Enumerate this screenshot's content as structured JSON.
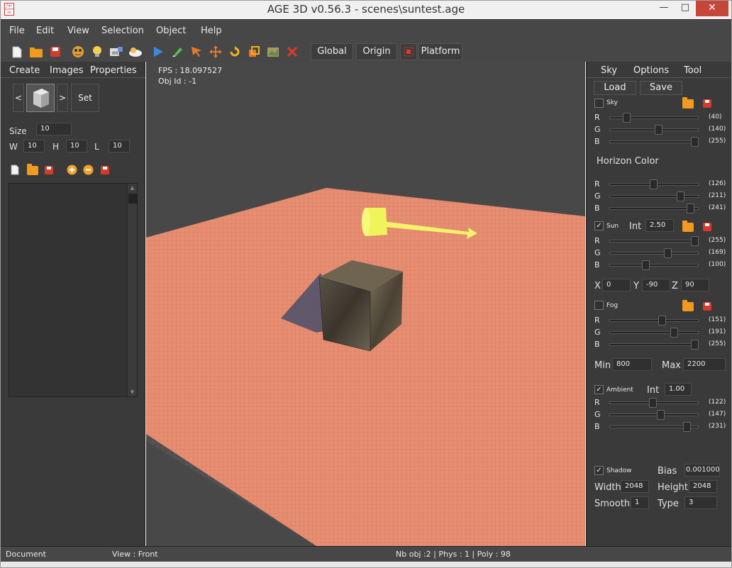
{
  "window": {
    "title": "AGE 3D v0.56.3 - scenes\\suntest.age",
    "app_icon_text": "Age Game Kit",
    "min": "—",
    "max": "□",
    "close": "✕"
  },
  "menu": [
    "File",
    "Edit",
    "View",
    "Selection",
    "Object",
    "Help"
  ],
  "toolbar": {
    "icons": [
      "new-file-icon",
      "open-folder-icon",
      "save-icon",
      "character-icon",
      "bulb-icon",
      "sprite-icon",
      "sky-icon",
      "play-icon",
      "pencil-icon",
      "select-arrow-icon",
      "move-icon",
      "rotate-icon",
      "scale-icon",
      "terrain-icon",
      "delete-icon"
    ],
    "global": "Global",
    "origin": "Origin",
    "platform": "Platform"
  },
  "left": {
    "tabs": [
      "Create",
      "Images",
      "Properties"
    ],
    "prev": "<",
    "next": ">",
    "set": "Set",
    "size_label": "Size",
    "size": "10",
    "w_label": "W",
    "w": "10",
    "h_label": "H",
    "h": "10",
    "l_label": "L",
    "l": "10"
  },
  "viewport": {
    "fps": "FPS : 18.097527",
    "objid": "Obj Id : -1"
  },
  "right": {
    "tabs": [
      "Sky",
      "Options",
      "Tool"
    ],
    "load": "Load",
    "save": "Save",
    "sky": {
      "label": "Sky",
      "checked": false,
      "r": "(40)",
      "g": "(140)",
      "b": "(255)",
      "rv": 40,
      "gv": 140,
      "bv": 255
    },
    "horizon": {
      "label": "Horizon Color",
      "r": "(126)",
      "g": "(211)",
      "b": "(241)",
      "rv": 126,
      "gv": 211,
      "bv": 241
    },
    "sun": {
      "label": "Sun",
      "checked": true,
      "int_label": "Int",
      "int": "2.50",
      "r": "(255)",
      "g": "(169)",
      "b": "(100)",
      "rv": 255,
      "gv": 169,
      "bv": 100
    },
    "xyz": {
      "x_label": "X",
      "x": "0",
      "y_label": "Y",
      "y": "-90",
      "z_label": "Z",
      "z": "90"
    },
    "fog": {
      "label": "Fog",
      "checked": false,
      "r": "(151)",
      "g": "(191)",
      "b": "(255)",
      "rv": 151,
      "gv": 191,
      "bv": 255
    },
    "minmax": {
      "min_label": "Min",
      "min": "800",
      "max_label": "Max",
      "max": "2200"
    },
    "ambient": {
      "label": "Ambient",
      "checked": true,
      "int_label": "Int",
      "int": "1.00",
      "r": "(122)",
      "g": "(147)",
      "b": "(231)",
      "rv": 122,
      "gv": 147,
      "bv": 231
    },
    "shadow": {
      "label": "Shadow",
      "checked": true,
      "bias_label": "Bias",
      "bias": "0.001000",
      "width_label": "Width",
      "width": "2048",
      "height_label": "Height",
      "height": "2048",
      "smooth_label": "Smooth",
      "smooth": "1",
      "type_label": "Type",
      "type": "3"
    },
    "rgb": {
      "r": "R",
      "g": "G",
      "b": "B"
    }
  },
  "status": {
    "document": "Document",
    "view": "View : Front",
    "stats": "Nb obj :2 | Phys : 1 | Poly : 98"
  },
  "colors": {
    "panel": "#3a3a3a",
    "bar": "#474747",
    "floor": "#e58a6e",
    "sun_gizmo": "#f3f36a"
  }
}
